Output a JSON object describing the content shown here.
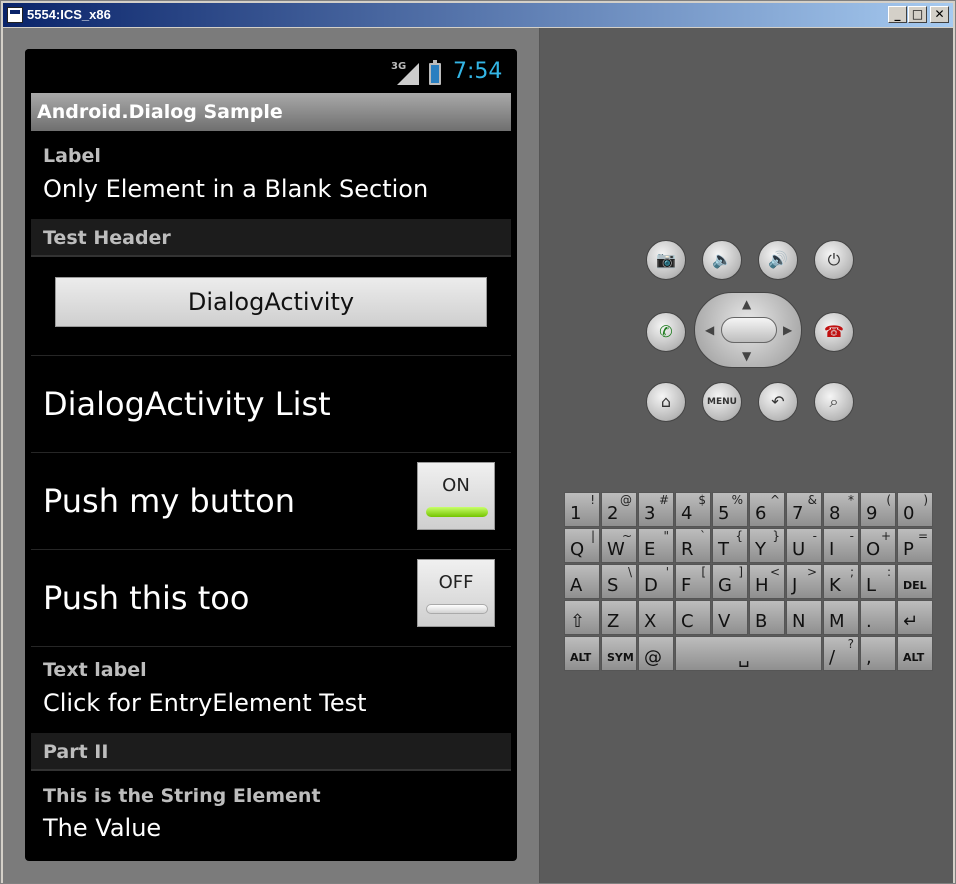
{
  "window": {
    "title": "5554:ICS_x86",
    "min": "_",
    "max": "□",
    "close": "✕"
  },
  "status": {
    "network": "3G",
    "time": "7:54"
  },
  "app": {
    "title": "Android.Dialog Sample"
  },
  "section1": {
    "label": "Label",
    "value": "Only Element in a Blank Section"
  },
  "header_test": "Test Header",
  "dialog_button": "DialogActivity",
  "dialog_list": "DialogActivity List",
  "row_push1": {
    "label": "Push my button",
    "toggle": "ON"
  },
  "row_push2": {
    "label": "Push this too",
    "toggle": "OFF"
  },
  "text_label": {
    "label": "Text label",
    "value": "Click for EntryElement Test"
  },
  "header_part2": "Part II",
  "string_element": {
    "label": "This is the String Element",
    "value": "The Value"
  },
  "controls": {
    "menu": "MENU",
    "icons": [
      "camera-icon",
      "volume-down-icon",
      "volume-up-icon",
      "power-icon",
      "call-icon",
      "end-call-icon",
      "home-icon",
      "menu-icon",
      "back-icon",
      "search-icon"
    ]
  },
  "keyboard": {
    "row1": [
      [
        "1",
        "!"
      ],
      [
        "2",
        "@"
      ],
      [
        "3",
        "#"
      ],
      [
        "4",
        "$"
      ],
      [
        "5",
        "%"
      ],
      [
        "6",
        "^"
      ],
      [
        "7",
        "&"
      ],
      [
        "8",
        "*"
      ],
      [
        "9",
        "("
      ],
      [
        "0",
        ")"
      ]
    ],
    "row2": [
      [
        "Q",
        "|"
      ],
      [
        "W",
        "~"
      ],
      [
        "E",
        "\""
      ],
      [
        "R",
        "`"
      ],
      [
        "T",
        "{"
      ],
      [
        "Y",
        "}"
      ],
      [
        "U",
        "-"
      ],
      [
        "I",
        "-"
      ],
      [
        "O",
        "+"
      ],
      [
        "P",
        "="
      ]
    ],
    "row3": [
      [
        "A",
        ""
      ],
      [
        "S",
        "\\"
      ],
      [
        "D",
        "'"
      ],
      [
        "F",
        "["
      ],
      [
        "G",
        "]"
      ],
      [
        "H",
        "<"
      ],
      [
        "J",
        ">"
      ],
      [
        "K",
        ";"
      ],
      [
        "L",
        ":"
      ],
      [
        "DEL",
        ""
      ]
    ],
    "row4": [
      [
        "⇧",
        ""
      ],
      [
        "Z",
        ""
      ],
      [
        "X",
        ""
      ],
      [
        "C",
        ""
      ],
      [
        "V",
        ""
      ],
      [
        "B",
        ""
      ],
      [
        "N",
        ""
      ],
      [
        "M",
        ""
      ],
      [
        ".",
        ""
      ],
      [
        "↵",
        ""
      ]
    ],
    "row5": {
      "alt_left": "ALT",
      "sym": "SYM",
      "at": "@",
      "space": "␣",
      "slash": "/",
      "question": "?",
      "comma": ",",
      "alt_right": "ALT"
    }
  }
}
